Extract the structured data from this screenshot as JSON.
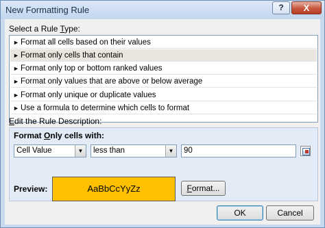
{
  "window": {
    "title": "New Formatting Rule",
    "help_label": "?",
    "close_label": "X"
  },
  "rule_type": {
    "label_prefix": "Select a Rule ",
    "label_accel": "T",
    "label_suffix": "ype:",
    "items": [
      {
        "label": "Format all cells based on their values",
        "selected": false
      },
      {
        "label": "Format only cells that contain",
        "selected": true
      },
      {
        "label": "Format only top or bottom ranked values",
        "selected": false
      },
      {
        "label": "Format only values that are above or below average",
        "selected": false
      },
      {
        "label": "Format only unique or duplicate values",
        "selected": false
      },
      {
        "label": "Use a formula to determine which cells to format",
        "selected": false
      }
    ],
    "bullet": "►"
  },
  "description": {
    "label_accel": "E",
    "label_rest": "dit the Rule Description:",
    "heading_accel": "O",
    "heading_prefix": "Format ",
    "heading_rest": "nly cells with:",
    "condition_type": "Cell Value",
    "operator": "less than",
    "value": "90",
    "preview_label": "Preview:",
    "preview_sample": "AaBbCcYyZz",
    "preview_color": "#ffc000",
    "format_button_accel": "F",
    "format_button_rest": "ormat..."
  },
  "footer": {
    "ok_label": "OK",
    "cancel_label": "Cancel"
  }
}
